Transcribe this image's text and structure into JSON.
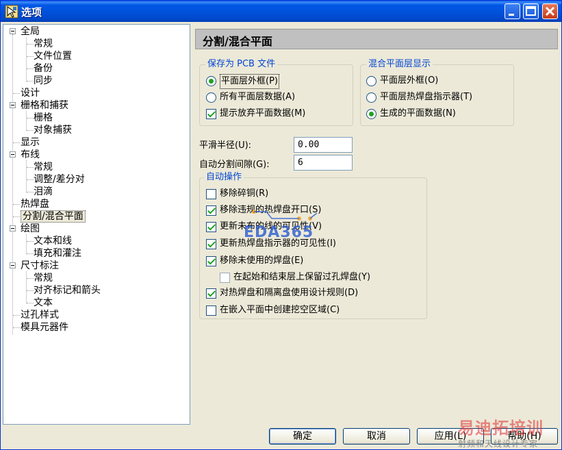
{
  "window": {
    "title": "选项"
  },
  "tree": {
    "items": [
      {
        "label": "全局",
        "level": 0,
        "expander": true
      },
      {
        "label": "常规",
        "level": 1
      },
      {
        "label": "文件位置",
        "level": 1
      },
      {
        "label": "备份",
        "level": 1
      },
      {
        "label": "同步",
        "level": 1
      },
      {
        "label": "设计",
        "level": 0
      },
      {
        "label": "栅格和捕获",
        "level": 0,
        "expander": true
      },
      {
        "label": "栅格",
        "level": 1
      },
      {
        "label": "对象捕获",
        "level": 1
      },
      {
        "label": "显示",
        "level": 0
      },
      {
        "label": "布线",
        "level": 0,
        "expander": true
      },
      {
        "label": "常规",
        "level": 1
      },
      {
        "label": "调整/差分对",
        "level": 1
      },
      {
        "label": "泪滴",
        "level": 1
      },
      {
        "label": "热焊盘",
        "level": 0
      },
      {
        "label": "分割/混合平面",
        "level": 0,
        "selected": true
      },
      {
        "label": "绘图",
        "level": 0,
        "expander": true
      },
      {
        "label": "文本和线",
        "level": 1
      },
      {
        "label": "填充和灌注",
        "level": 1
      },
      {
        "label": "尺寸标注",
        "level": 0,
        "expander": true
      },
      {
        "label": "常规",
        "level": 1
      },
      {
        "label": "对齐标记和箭头",
        "level": 1
      },
      {
        "label": "文本",
        "level": 1
      },
      {
        "label": "过孔样式",
        "level": 0
      },
      {
        "label": "模具元器件",
        "level": 0
      }
    ]
  },
  "panel": {
    "title": "分割/混合平面",
    "save_as_pcb": {
      "legend": "保存为 PCB 文件",
      "opt_outline": "平面层外框(P)",
      "opt_all_data": "所有平面层数据(A)",
      "opt_prompt": "提示放弃平面数据(M)"
    },
    "mixed_display": {
      "legend": "混合平面层显示",
      "opt_outline": "平面层外框(O)",
      "opt_thermal": "平面层热焊盘指示器(T)",
      "opt_generated": "生成的平面数据(N)"
    },
    "smooth_radius": {
      "label": "平滑半径(U):",
      "value": "0.00"
    },
    "auto_gap": {
      "label": "自动分割间隙(G):",
      "value": "6"
    },
    "auto_ops": {
      "legend": "自动操作",
      "remove_copper": "移除碎铜(R)",
      "remove_thermal": "移除违规的热焊盘开口(S)",
      "update_visibility": "更新未布的线的可见性(V)",
      "update_thermal": "更新热焊盘指示器的可见性(I)",
      "remove_unused": "移除未使用的焊盘(E)",
      "keep_via": "在起始和结束层上保留过孔焊盘(Y)",
      "use_rules": "对热焊盘和隔离盘使用设计规则(D)",
      "create_cutout": "在嵌入平面中创建挖空区域(C)"
    }
  },
  "buttons": {
    "ok": "确定",
    "cancel": "取消",
    "apply": "应用(L)",
    "help": "帮助(H)"
  },
  "watermarks": {
    "logo": "EDA365",
    "brand": "易迪拓培训",
    "slogan": "射频和天线设计专家"
  }
}
